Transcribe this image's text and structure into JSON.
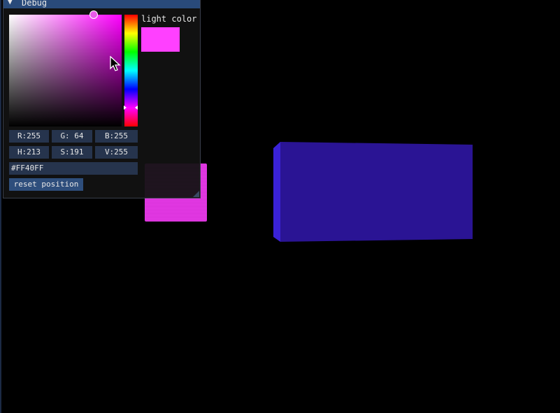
{
  "window": {
    "title": "Debug",
    "collapse_arrow_icon": "triangle-down-icon"
  },
  "color_picker": {
    "label": "light color",
    "swatch_color": "#FF40FF",
    "hue_colors": [
      "#ff0000",
      "#ffff00",
      "#00ff00",
      "#00ffff",
      "#0000ff",
      "#ff00ff",
      "#ff0000"
    ],
    "fields": {
      "r": "R:255",
      "g": "G: 64",
      "b": "B:255",
      "h": "H:213",
      "s": "S:191",
      "v": "V:255",
      "hex": "#FF40FF"
    }
  },
  "buttons": {
    "reset_position": "reset position"
  },
  "scene": {
    "background_color": "#000000",
    "pink_cube_color": "#E53AE6",
    "blue_box_color": "#2A1494"
  }
}
